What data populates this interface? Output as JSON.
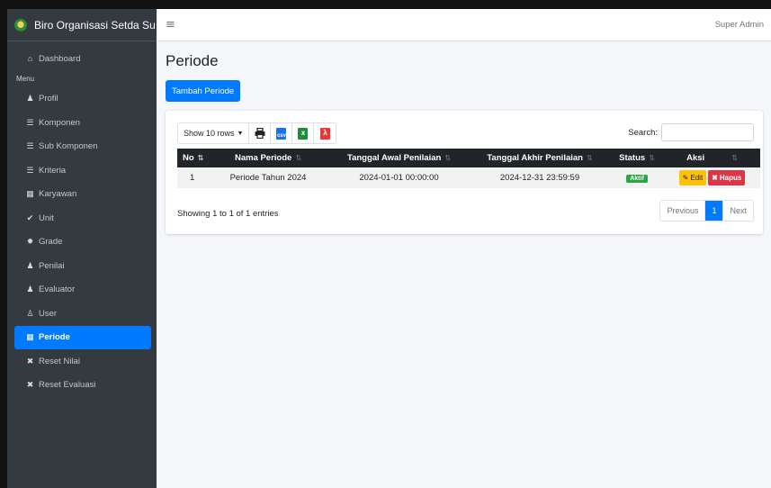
{
  "brand": {
    "title": "Biro Organisasi Setda Su"
  },
  "topbar": {
    "menu_icon": "hamburger-icon",
    "user": "Super Admin"
  },
  "sidebar": {
    "dashboard": "Dashboard",
    "menu_header": "Menu",
    "items": [
      {
        "label": "Profil",
        "icon": "user-icon"
      },
      {
        "label": "Komponen",
        "icon": "list-icon"
      },
      {
        "label": "Sub Komponen",
        "icon": "list-icon"
      },
      {
        "label": "Kriteria",
        "icon": "list-icon"
      },
      {
        "label": "Karyawan",
        "icon": "building-icon"
      },
      {
        "label": "Unit",
        "icon": "check-icon"
      },
      {
        "label": "Grade",
        "icon": "gear-icon"
      },
      {
        "label": "Penilai",
        "icon": "user-icon"
      },
      {
        "label": "Evaluator",
        "icon": "user-icon"
      },
      {
        "label": "User",
        "icon": "users-icon"
      },
      {
        "label": "Periode",
        "icon": "calendar-icon",
        "active": true
      },
      {
        "label": "Reset Nilai",
        "icon": "x-icon"
      },
      {
        "label": "Reset Evaluasi",
        "icon": "x-icon"
      }
    ]
  },
  "main": {
    "title": "Periode",
    "add_button": "Tambah Periode",
    "toolbar": {
      "show_rows": "Show 10 rows"
    },
    "search_label": "Search:",
    "search_value": "",
    "table": {
      "headers": [
        "No",
        "Nama Periode",
        "Tanggal Awal Penilaian",
        "Tanggal Akhir Penilaian",
        "Status",
        "Aksi"
      ],
      "rows": [
        {
          "no": "1",
          "nama": "Periode Tahun 2024",
          "awal": "2024-01-01 00:00:00",
          "akhir": "2024-12-31 23:59:59",
          "status": "Aktif",
          "edit": "Edit",
          "hapus": "Hapus"
        }
      ]
    },
    "info": "Showing 1 to 1 of 1 entries",
    "pagination": {
      "prev": "Previous",
      "current": "1",
      "next": "Next"
    }
  },
  "colors": {
    "sidebar": "#343a40",
    "primary": "#007bff",
    "success": "#28a745",
    "warning": "#ffc107",
    "danger": "#dc3545"
  }
}
